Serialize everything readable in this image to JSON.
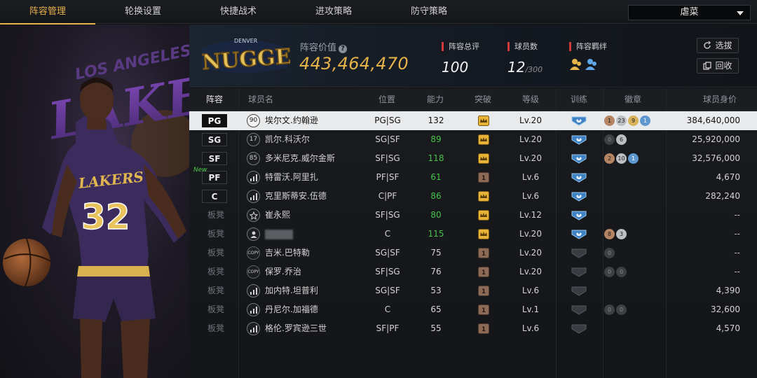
{
  "nav": {
    "tabs": [
      "阵容管理",
      "轮换设置",
      "快捷战术",
      "进攻策略",
      "防守策略"
    ],
    "active_index": 0,
    "dropdown_value": "虐菜"
  },
  "art": {
    "team_text": "LOS ANGELES",
    "team_wordmark": "LAKERS",
    "jersey_text": "LAKERS",
    "jersey_number": "32"
  },
  "team": {
    "logo_text": "NUGGETS",
    "logo_small_text": "DENVER",
    "value_label": "阵容价值",
    "value": "443,464,470",
    "rating_label": "阵容总评",
    "rating": "100",
    "players_label": "球员数",
    "players": "12",
    "players_max": "/300",
    "bond_label": "阵容羁绊",
    "btn_select": "选拔",
    "btn_recycle": "回收"
  },
  "table": {
    "headers": {
      "slot": "阵容",
      "name": "球员名",
      "position": "位置",
      "ability": "能力",
      "breakthrough": "突破",
      "level": "等级",
      "training": "训练",
      "badges": "徽章",
      "value": "球员身价"
    },
    "rows": [
      {
        "slot": "PG",
        "bench": false,
        "new": false,
        "pic": "90",
        "pic_type": "num",
        "name": "埃尔文.约翰逊",
        "position": "PG|SG",
        "ability": "132",
        "ability_green": false,
        "break": "gold",
        "level": "Lv.20",
        "train": "active",
        "badges": [
          {
            "t": "bronze",
            "v": "1"
          },
          {
            "t": "silver",
            "v": "23"
          },
          {
            "t": "gold",
            "v": "9"
          },
          {
            "t": "blue",
            "v": "1"
          }
        ],
        "value": "384,640,000"
      },
      {
        "slot": "SG",
        "bench": false,
        "new": false,
        "pic": "17",
        "pic_type": "num",
        "name": "凯尔.科沃尔",
        "position": "SG|SF",
        "ability": "89",
        "ability_green": true,
        "break": "gold",
        "level": "Lv.20",
        "train": "active",
        "badges": [
          {
            "t": "empty",
            "v": "0"
          },
          {
            "t": "silver",
            "v": "6"
          }
        ],
        "value": "25,920,000"
      },
      {
        "slot": "SF",
        "bench": false,
        "new": false,
        "pic": "85",
        "pic_type": "num",
        "name": "多米尼克.威尔金斯",
        "position": "SF|SG",
        "ability": "118",
        "ability_green": true,
        "break": "gold",
        "level": "Lv.20",
        "train": "active",
        "badges": [
          {
            "t": "bronze",
            "v": "2"
          },
          {
            "t": "silver",
            "v": "10"
          },
          {
            "t": "blue",
            "v": "1"
          }
        ],
        "value": "32,576,000"
      },
      {
        "slot": "PF",
        "bench": false,
        "new": true,
        "new_label": "New",
        "pic": "",
        "pic_type": "bars",
        "name": "特雷沃.阿里扎",
        "position": "PF|SF",
        "ability": "61",
        "ability_green": true,
        "break": "bronze",
        "level": "Lv.6",
        "train": "active",
        "badges": [],
        "value": "4,670"
      },
      {
        "slot": "C",
        "bench": false,
        "new": false,
        "pic": "",
        "pic_type": "bars",
        "name": "克里斯蒂安.伍德",
        "position": "C|PF",
        "ability": "86",
        "ability_green": true,
        "break": "gold",
        "level": "Lv.6",
        "train": "active",
        "badges": [],
        "value": "282,240"
      },
      {
        "slot": "板凳",
        "bench": true,
        "new": false,
        "pic": "",
        "pic_type": "star",
        "name": "崔永熙",
        "position": "SF|SG",
        "ability": "80",
        "ability_green": true,
        "break": "gold",
        "level": "Lv.12",
        "train": "active",
        "badges": [],
        "value": "--"
      },
      {
        "slot": "板凳",
        "bench": true,
        "new": false,
        "pic": "",
        "pic_type": "person",
        "name": "",
        "blurred": true,
        "position": "C",
        "ability": "115",
        "ability_green": true,
        "break": "gold",
        "level": "Lv.20",
        "train": "active",
        "badges": [
          {
            "t": "bronze",
            "v": "8"
          },
          {
            "t": "silver",
            "v": "3"
          }
        ],
        "value": "--"
      },
      {
        "slot": "板凳",
        "bench": true,
        "new": false,
        "pic": "COPY",
        "pic_type": "copy",
        "name": "吉米.巴特勒",
        "position": "SG|SF",
        "ability": "75",
        "ability_green": false,
        "break": "bronze",
        "level": "Lv.20",
        "train": "inactive",
        "badges": [
          {
            "t": "empty",
            "v": "0"
          }
        ],
        "value": "--"
      },
      {
        "slot": "板凳",
        "bench": true,
        "new": false,
        "pic": "COPY",
        "pic_type": "copy",
        "name": "保罗.乔治",
        "position": "SF|SG",
        "ability": "76",
        "ability_green": false,
        "break": "bronze",
        "level": "Lv.20",
        "train": "inactive",
        "badges": [
          {
            "t": "empty",
            "v": "0"
          },
          {
            "t": "empty",
            "v": "0"
          }
        ],
        "value": "--"
      },
      {
        "slot": "板凳",
        "bench": true,
        "new": false,
        "pic": "",
        "pic_type": "bars",
        "name": "加内特.坦普利",
        "position": "SG|SF",
        "ability": "53",
        "ability_green": false,
        "break": "bronze",
        "level": "Lv.6",
        "train": "inactive",
        "badges": [],
        "value": "4,390"
      },
      {
        "slot": "板凳",
        "bench": true,
        "new": false,
        "pic": "",
        "pic_type": "bars",
        "name": "丹尼尔.加福德",
        "position": "C",
        "ability": "65",
        "ability_green": false,
        "break": "bronze",
        "level": "Lv.1",
        "train": "inactive",
        "badges": [
          {
            "t": "empty",
            "v": "0"
          },
          {
            "t": "empty",
            "v": "0"
          }
        ],
        "value": "32,600"
      },
      {
        "slot": "板凳",
        "bench": true,
        "new": false,
        "pic": "",
        "pic_type": "bars",
        "name": "格伦.罗宾逊三世",
        "position": "SF|PF",
        "ability": "55",
        "ability_green": false,
        "break": "bronze",
        "level": "Lv.6",
        "train": "inactive",
        "badges": [],
        "value": "4,570"
      }
    ]
  },
  "colors": {
    "accent": "#e6b24a",
    "green": "#45c24a",
    "red": "#d13a3a"
  }
}
